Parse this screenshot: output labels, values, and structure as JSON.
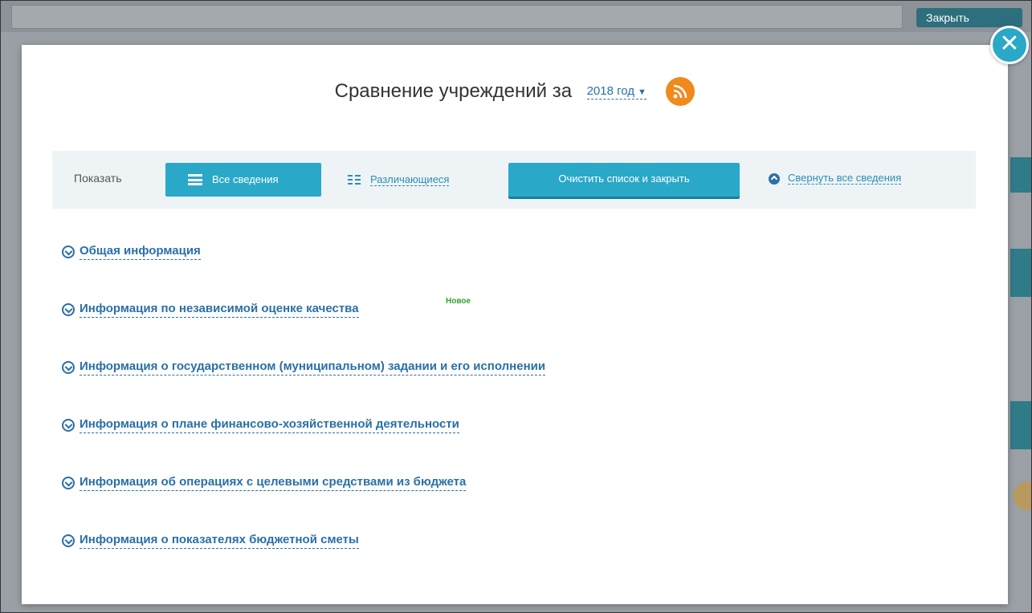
{
  "background": {
    "close_label": "Закрыть"
  },
  "modal": {
    "title": "Сравнение учреждений за",
    "year_select": "2018 год",
    "toolbar": {
      "show_label": "Показать",
      "all_info_label": "Все сведения",
      "differing_label": "Различающиеся",
      "clear_label": "Очистить список и закрыть",
      "collapse_label": "Свернуть все сведения"
    },
    "sections": [
      {
        "label": "Общая информация",
        "badge": ""
      },
      {
        "label": "Информация по независимой оценке качества",
        "badge": "Новое"
      },
      {
        "label": "Информация о государственном (муниципальном) задании и его исполнении",
        "badge": ""
      },
      {
        "label": "Информация о плане финансово-хозяйственной деятельности",
        "badge": ""
      },
      {
        "label": "Информация об операциях с целевыми средствами из бюджета",
        "badge": ""
      },
      {
        "label": "Информация о показателях бюджетной сметы",
        "badge": ""
      }
    ]
  },
  "colors": {
    "accent": "#2aa8c7",
    "link": "#2a6fa8",
    "rss": "#f08a1c",
    "badge_new": "#2fa02f"
  }
}
